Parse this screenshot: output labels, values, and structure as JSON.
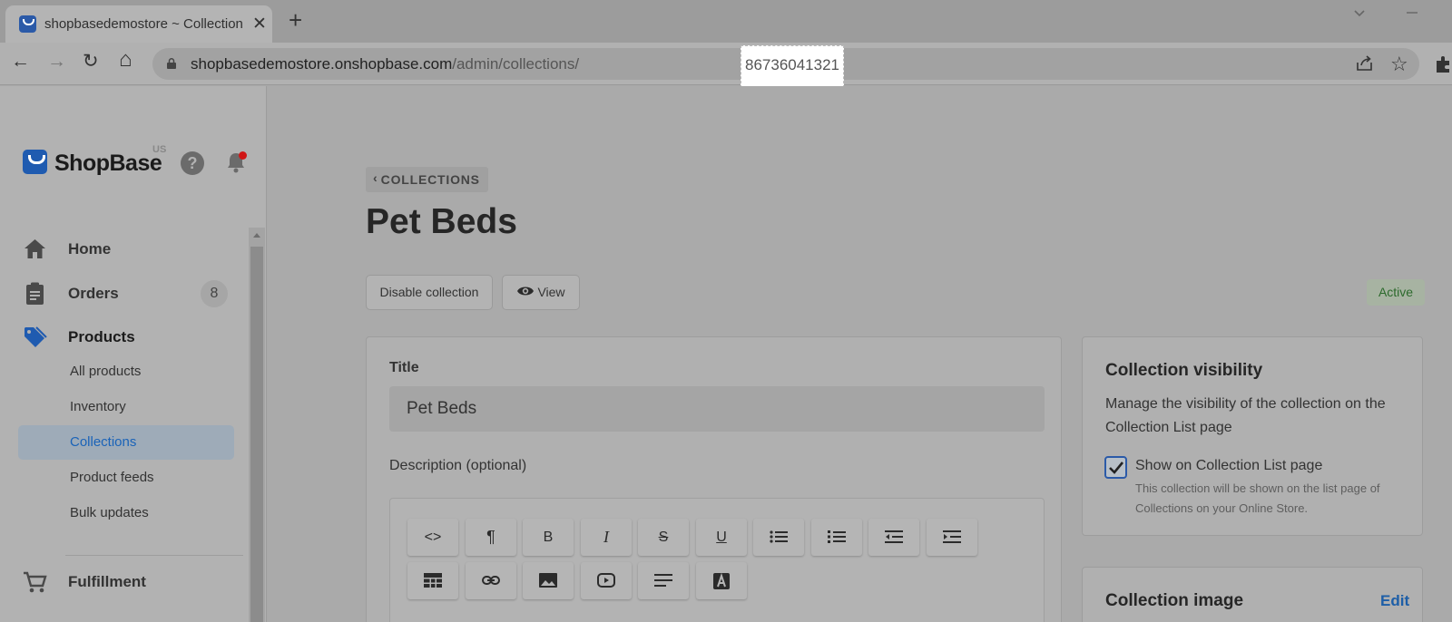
{
  "browser": {
    "tab_title": "shopbasedemostore ~ Collections",
    "tab_close": "✕",
    "new_tab": "+",
    "url_host": "shopbasedemostore.onshopbase.com",
    "url_path": "/admin/collections/",
    "url_id": "86736041321",
    "back": "←",
    "forward": "→",
    "reload": "↻",
    "home": "⌂",
    "bookmark": "☆"
  },
  "brand": {
    "name": "ShopBase",
    "region": "US",
    "help": "?"
  },
  "sidebar": {
    "nav": [
      {
        "label": "Home",
        "icon": "home-icon"
      },
      {
        "label": "Orders",
        "icon": "clipboard-icon",
        "badge": "8"
      },
      {
        "label": "Products",
        "icon": "tag-icon"
      },
      {
        "label": "Fulfillment",
        "icon": "cart-icon"
      }
    ],
    "product_sub": [
      {
        "label": "All products"
      },
      {
        "label": "Inventory"
      },
      {
        "label": "Collections",
        "active": true
      },
      {
        "label": "Product feeds"
      },
      {
        "label": "Bulk updates"
      }
    ]
  },
  "page": {
    "breadcrumb": "COLLECTIONS",
    "title": "Pet Beds",
    "disable_button": "Disable collection",
    "view_button": "View",
    "status": "Active"
  },
  "form": {
    "title_label": "Title",
    "title_value": "Pet Beds",
    "description_label": "Description (optional)",
    "toolbar": [
      {
        "name": "html-source-button",
        "text": "<>"
      },
      {
        "name": "paragraph-button",
        "text": "¶"
      },
      {
        "name": "bold-button",
        "text": "B"
      },
      {
        "name": "italic-button",
        "text": "I"
      },
      {
        "name": "strikethrough-button",
        "text": "S"
      },
      {
        "name": "underline-button",
        "text": "U"
      },
      {
        "name": "bulleted-list-button",
        "text": ""
      },
      {
        "name": "numbered-list-button",
        "text": ""
      },
      {
        "name": "outdent-button",
        "text": ""
      },
      {
        "name": "indent-button",
        "text": ""
      },
      {
        "name": "table-button",
        "text": ""
      },
      {
        "name": "link-button",
        "text": ""
      },
      {
        "name": "image-button",
        "text": ""
      },
      {
        "name": "video-button",
        "text": ""
      },
      {
        "name": "align-button",
        "text": ""
      },
      {
        "name": "text-color-button",
        "text": ""
      }
    ]
  },
  "visibility": {
    "heading": "Collection visibility",
    "description": "Manage the visibility of the collection on the Collection List page",
    "checkbox_label": "Show on Collection List page",
    "checked": true,
    "help": "This collection will be shown on the list page of Collections on your Online Store."
  },
  "image_card": {
    "heading": "Collection image",
    "edit": "Edit"
  },
  "colors": {
    "brand_blue": "#1f5bb0",
    "link_blue": "#1d5ea7",
    "active_green": "#2c6a2c",
    "notification_red": "#d01616"
  }
}
